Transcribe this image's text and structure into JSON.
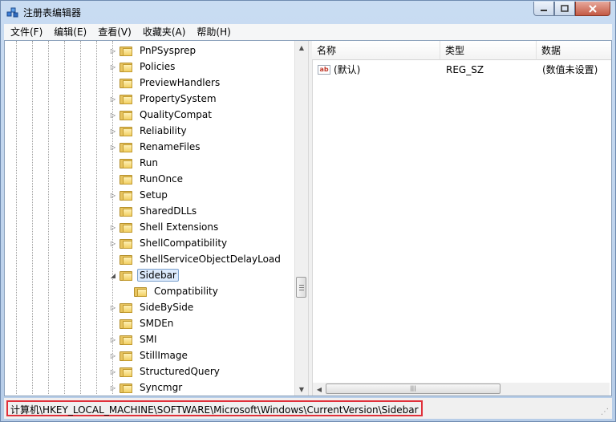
{
  "window": {
    "title": "注册表编辑器"
  },
  "menu": [
    "文件(F)",
    "编辑(E)",
    "查看(V)",
    "收藏夹(A)",
    "帮助(H)"
  ],
  "tree": {
    "nodes": [
      {
        "label": "PnPSysprep",
        "expander": "▷"
      },
      {
        "label": "Policies",
        "expander": "▷"
      },
      {
        "label": "PreviewHandlers",
        "expander": ""
      },
      {
        "label": "PropertySystem",
        "expander": "▷"
      },
      {
        "label": "QualityCompat",
        "expander": "▷"
      },
      {
        "label": "Reliability",
        "expander": "▷"
      },
      {
        "label": "RenameFiles",
        "expander": "▷"
      },
      {
        "label": "Run",
        "expander": ""
      },
      {
        "label": "RunOnce",
        "expander": ""
      },
      {
        "label": "Setup",
        "expander": "▷"
      },
      {
        "label": "SharedDLLs",
        "expander": ""
      },
      {
        "label": "Shell Extensions",
        "expander": "▷"
      },
      {
        "label": "ShellCompatibility",
        "expander": "▷"
      },
      {
        "label": "ShellServiceObjectDelayLoad",
        "expander": ""
      },
      {
        "label": "Sidebar",
        "expander": "◢",
        "selected": true
      },
      {
        "label": "Compatibility",
        "expander": "",
        "child": true
      },
      {
        "label": "SideBySide",
        "expander": "▷"
      },
      {
        "label": "SMDEn",
        "expander": ""
      },
      {
        "label": "SMI",
        "expander": "▷"
      },
      {
        "label": "StillImage",
        "expander": "▷"
      },
      {
        "label": "StructuredQuery",
        "expander": "▷"
      },
      {
        "label": "Syncmgr",
        "expander": "▷"
      }
    ]
  },
  "list": {
    "columns": [
      "名称",
      "类型",
      "数据"
    ],
    "rows": [
      {
        "icon": "ab",
        "name": "(默认)",
        "type": "REG_SZ",
        "data": "(数值未设置)"
      }
    ]
  },
  "status": {
    "path": "计算机\\HKEY_LOCAL_MACHINE\\SOFTWARE\\Microsoft\\Windows\\CurrentVersion\\Sidebar"
  },
  "colors": {
    "highlight_border": "#e0303a",
    "selection": "#dceafc"
  },
  "icons": [
    "registry-editor-icon",
    "minimize-icon",
    "maximize-icon",
    "close-icon",
    "folder-icon",
    "string-value-icon",
    "size-grip-icon"
  ]
}
